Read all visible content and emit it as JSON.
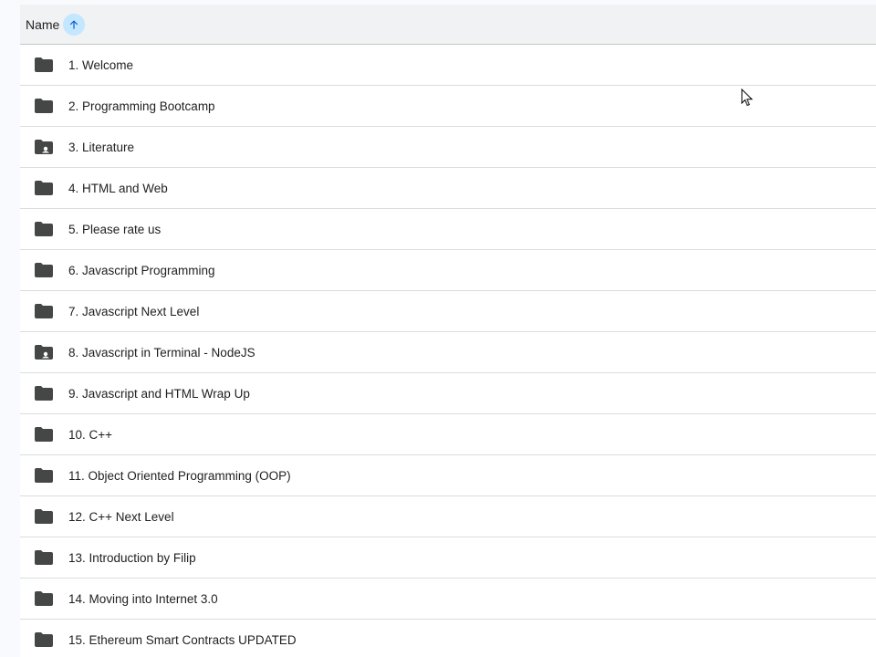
{
  "header": {
    "name_label": "Name",
    "sort_direction": "ascending"
  },
  "folders": [
    {
      "label": "1. Welcome",
      "icon": "folder-icon"
    },
    {
      "label": "2. Programming Bootcamp",
      "icon": "folder-icon"
    },
    {
      "label": "3. Literature",
      "icon": "shared-folder-icon"
    },
    {
      "label": "4. HTML and Web",
      "icon": "folder-icon"
    },
    {
      "label": "5. Please rate us",
      "icon": "folder-icon"
    },
    {
      "label": "6. Javascript Programming",
      "icon": "folder-icon"
    },
    {
      "label": "7. Javascript Next Level",
      "icon": "folder-icon"
    },
    {
      "label": "8. Javascript in Terminal - NodeJS",
      "icon": "shared-folder-icon"
    },
    {
      "label": "9. Javascript and HTML Wrap Up",
      "icon": "folder-icon"
    },
    {
      "label": "10. C++",
      "icon": "folder-icon"
    },
    {
      "label": "11. Object Oriented Programming (OOP)",
      "icon": "folder-icon"
    },
    {
      "label": "12. C++ Next Level",
      "icon": "folder-icon"
    },
    {
      "label": "13. Introduction by Filip",
      "icon": "folder-icon"
    },
    {
      "label": "14. Moving into Internet 3.0",
      "icon": "folder-icon"
    },
    {
      "label": "15. Ethereum Smart Contracts UPDATED",
      "icon": "folder-icon"
    }
  ],
  "colors": {
    "folder": "#444746",
    "sort_accent": "#c2e7ff",
    "sort_arrow": "#0b57d0",
    "divider": "#dadce0"
  }
}
